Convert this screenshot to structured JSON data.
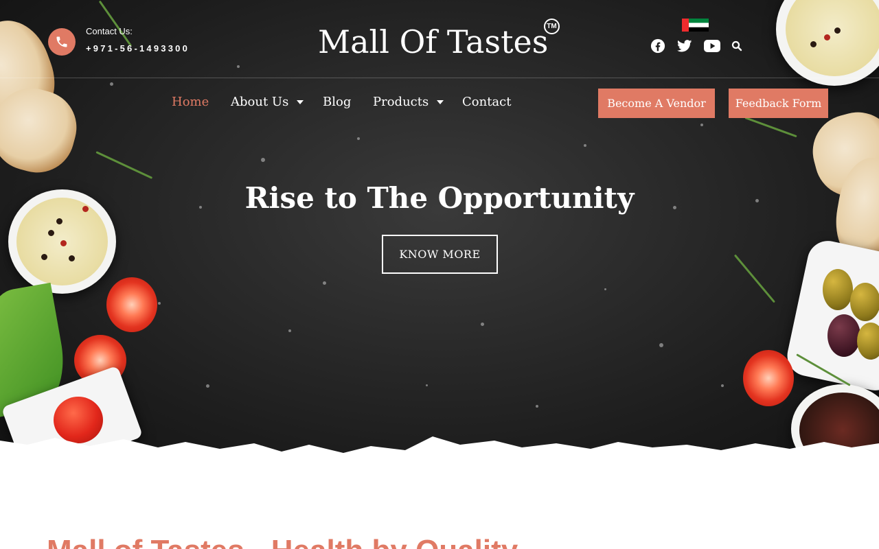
{
  "header": {
    "contact_label": "Contact Us:",
    "contact_phone": "+971-56-1493300",
    "logo_text": "Mall Of Tastes",
    "logo_mark": "TM",
    "social_icons": [
      "facebook-icon",
      "twitter-icon",
      "youtube-icon",
      "search-icon"
    ]
  },
  "nav": {
    "items": [
      {
        "label": "Home",
        "active": true
      },
      {
        "label": "About Us",
        "dropdown": true
      },
      {
        "label": "Blog"
      },
      {
        "label": "Products",
        "dropdown": true
      },
      {
        "label": "Contact"
      }
    ],
    "vendor_button": "Become A Vendor",
    "feedback_button": "Feedback Form"
  },
  "hero": {
    "title": "Rise to The Opportunity",
    "cta": "KNOW MORE"
  },
  "section": {
    "heading": "Mall of Tastes - Health by Quality"
  },
  "colors": {
    "accent": "#e07a64",
    "hero_bg": "#2b2b2b",
    "text_light": "#ffffff"
  }
}
